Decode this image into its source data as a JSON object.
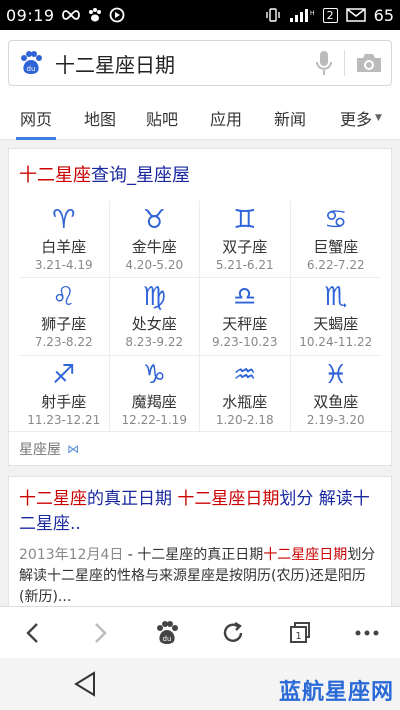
{
  "status_bar": {
    "time": "09:19",
    "sim_badge": "2",
    "battery": "65",
    "icons": [
      "infinity-icon",
      "paw-icon",
      "media-circle-icon",
      "vibrate-icon",
      "signal-icon",
      "mail-icon"
    ]
  },
  "search": {
    "query": "十二星座日期",
    "icons": [
      "baidu-paw-icon",
      "microphone-icon",
      "camera-icon"
    ]
  },
  "tabs": [
    {
      "label": "网页",
      "active": true
    },
    {
      "label": "地图"
    },
    {
      "label": "贴吧"
    },
    {
      "label": "应用"
    },
    {
      "label": "新闻"
    },
    {
      "label": "更多"
    }
  ],
  "result1": {
    "title_highlight": "十二星座",
    "title_rest": "查询_星座屋",
    "zodiac": [
      {
        "symbol": "♈",
        "name": "白羊座",
        "dates": "3.21-4.19"
      },
      {
        "symbol": "♉",
        "name": "金牛座",
        "dates": "4.20-5.20"
      },
      {
        "symbol": "♊",
        "name": "双子座",
        "dates": "5.21-6.21"
      },
      {
        "symbol": "♋",
        "name": "巨蟹座",
        "dates": "6.22-7.22"
      },
      {
        "symbol": "♌",
        "name": "狮子座",
        "dates": "7.23-8.22"
      },
      {
        "symbol": "♍",
        "name": "处女座",
        "dates": "8.23-9.22"
      },
      {
        "symbol": "♎",
        "name": "天秤座",
        "dates": "9.23-10.23"
      },
      {
        "symbol": "♏",
        "name": "天蝎座",
        "dates": "10.24-11.22"
      },
      {
        "symbol": "♐",
        "name": "射手座",
        "dates": "11.23-12.21"
      },
      {
        "symbol": "♑",
        "name": "魔羯座",
        "dates": "12.22-1.19"
      },
      {
        "symbol": "♒",
        "name": "水瓶座",
        "dates": "1.20-2.18"
      },
      {
        "symbol": "♓",
        "name": "双鱼座",
        "dates": "2.19-3.20"
      }
    ],
    "source": "星座屋",
    "source_badge": "⋈"
  },
  "result2": {
    "title_p1": "十二星座",
    "title_p2": "的真正日期 ",
    "title_p3": "十二星座日期",
    "title_p4": "划分 解读十二星座..",
    "date": "2013年12月4日",
    "abs_p1": " - 十二星座的真正日期",
    "abs_hl": "十二星座日期",
    "abs_p2": "划分解读十二星座的性格与来源星座是按阴历(农历)还是阳历(新历)..."
  },
  "toolbar": {
    "icons": [
      "back-arrow-icon",
      "forward-arrow-icon",
      "baidu-home-icon",
      "refresh-icon",
      "tabs-icon",
      "menu-dots-icon"
    ],
    "tab_count": "1"
  },
  "watermark": "蓝航星座网",
  "colors": {
    "accent_blue": "#3b7fe0",
    "highlight_red": "#cc0000",
    "link_blue": "#1a28a0",
    "zodiac_blue": "#2f63d8"
  }
}
